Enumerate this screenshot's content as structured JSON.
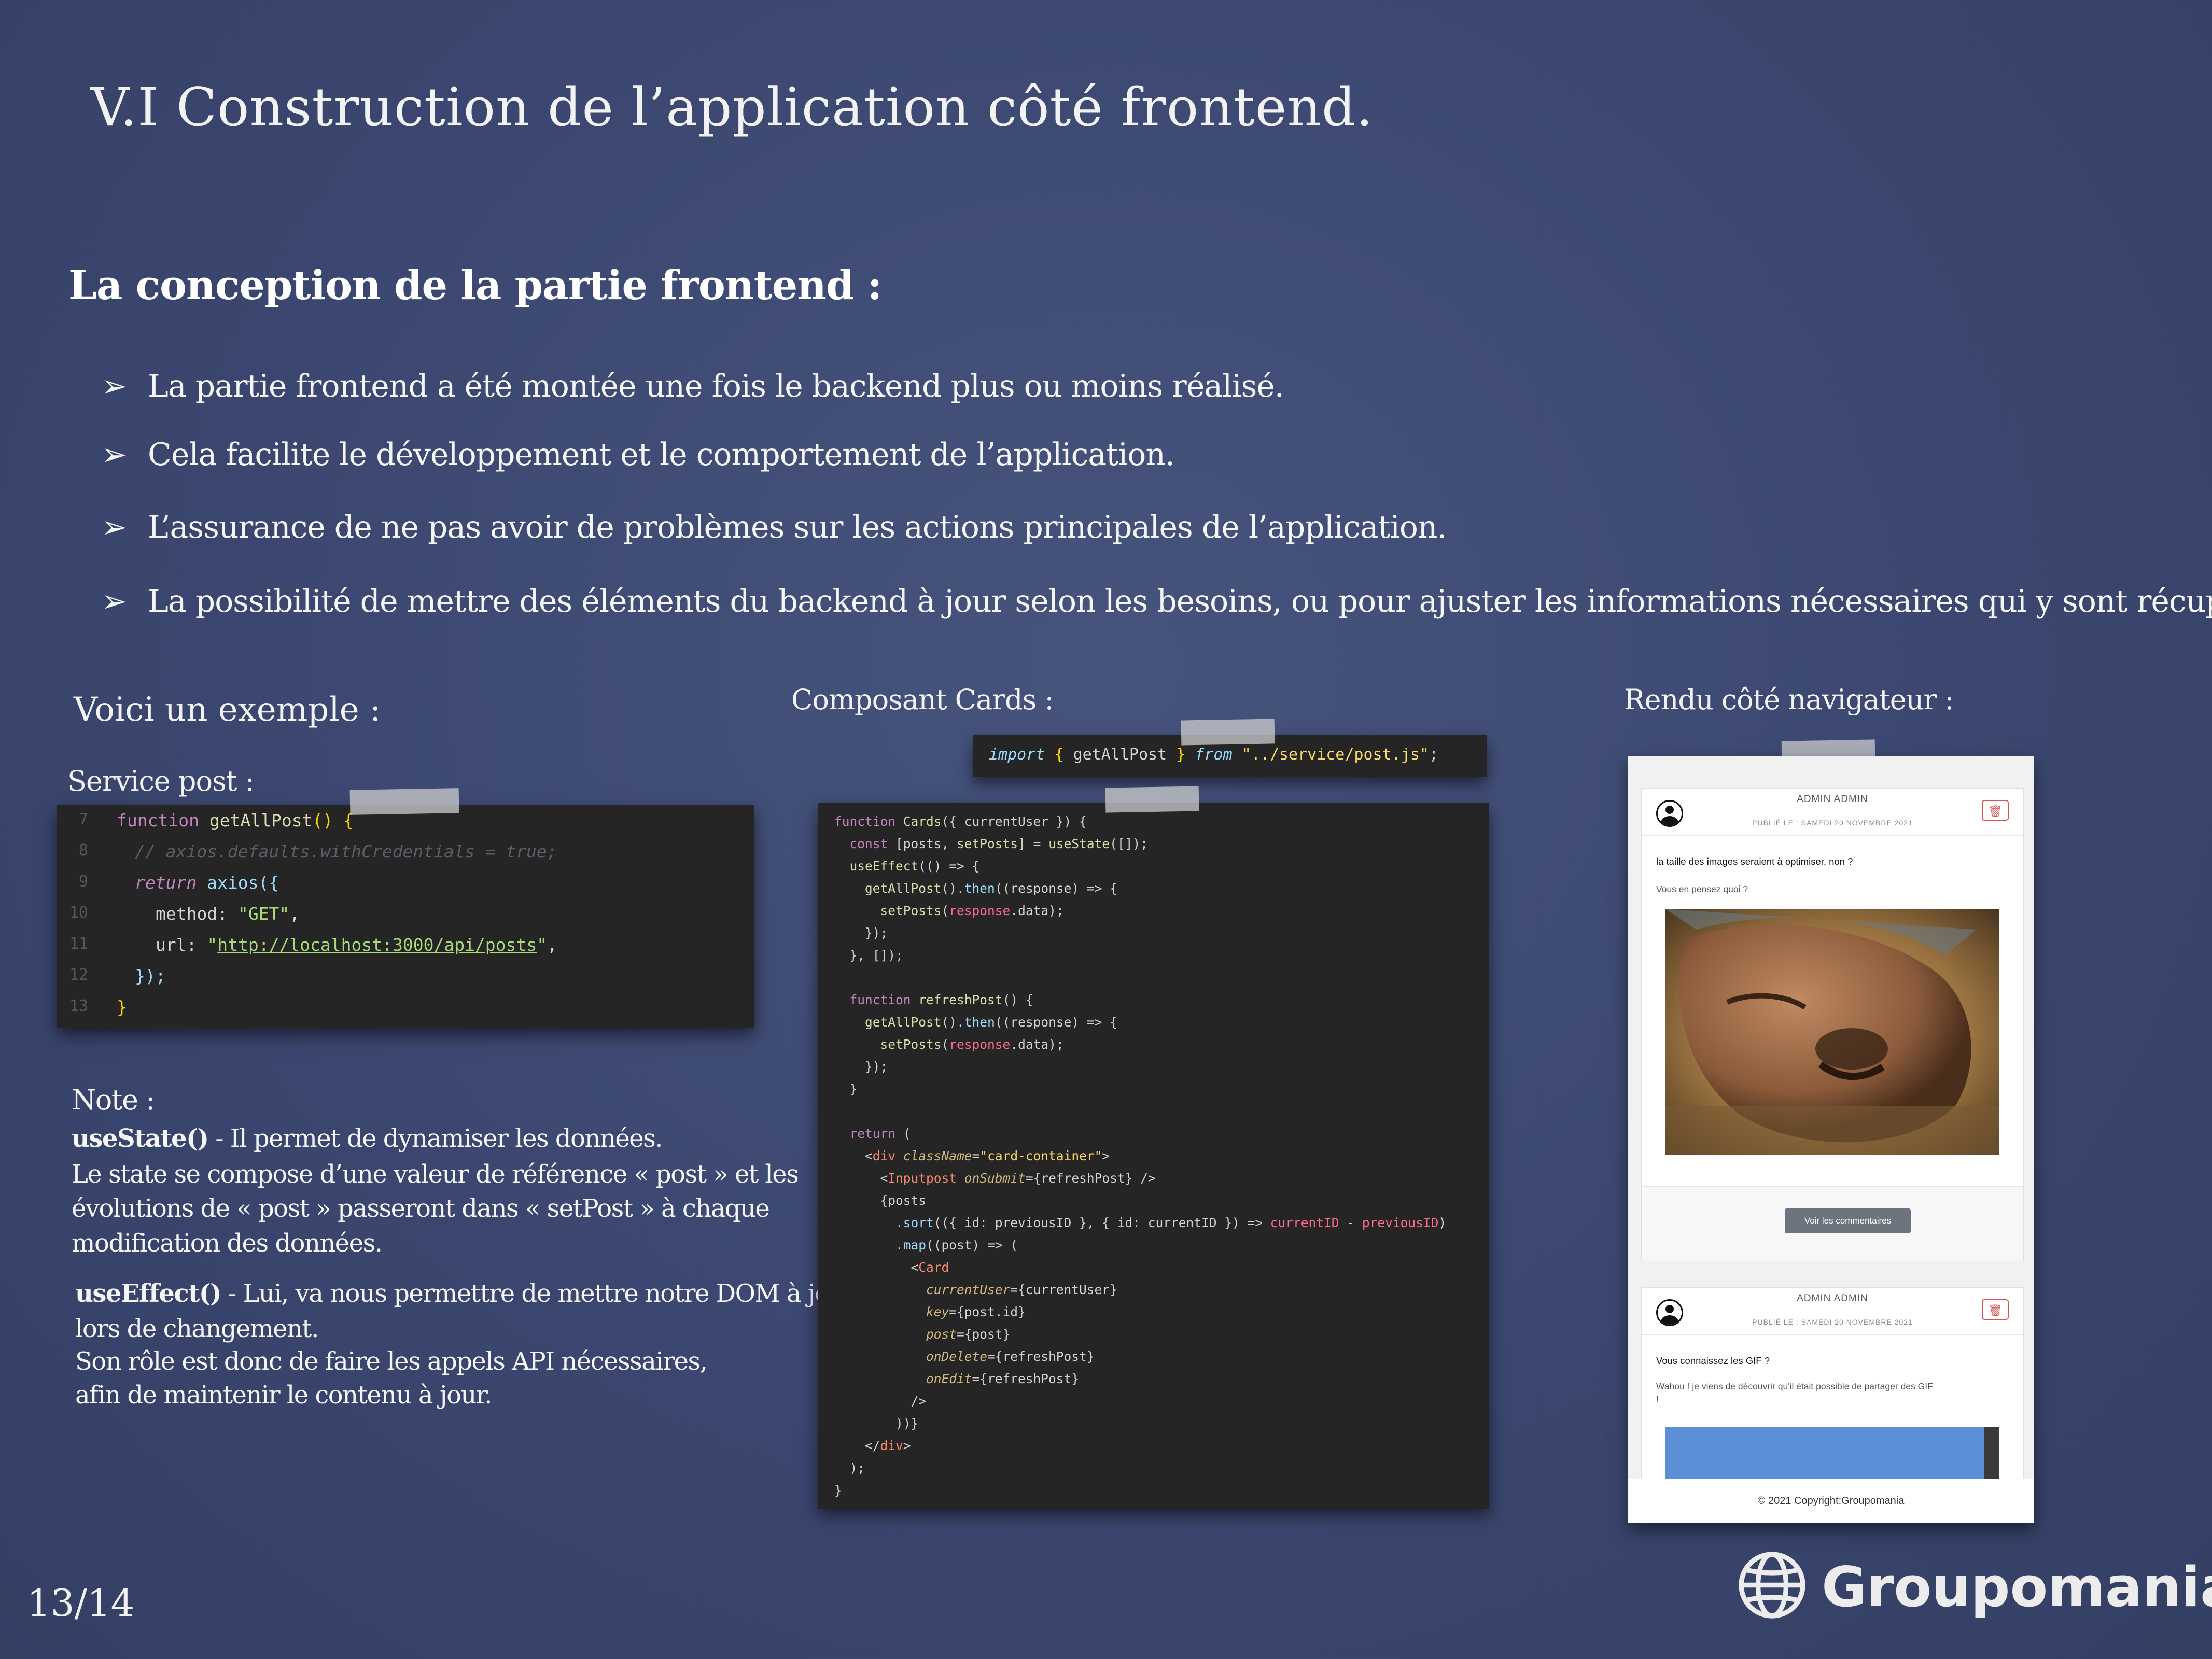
{
  "slide": {
    "title": "V.I  Construction de l’application côté frontend.",
    "subtitle": "La conception de la partie frontend :",
    "bullets": [
      "La partie frontend a été montée une fois le backend plus ou moins réalisé.",
      "Cela facilite le développement et le comportement de l’application.",
      "L’assurance de ne pas avoir de problèmes sur les actions principales de l’application.",
      "La possibilité de mettre des éléments du backend à jour selon les besoins, ou pour ajuster les informations nécessaires qui y sont récupérées."
    ],
    "bullet_glyph": "➢",
    "page_number": "13/14"
  },
  "example": {
    "heading": "Voici un exemple :",
    "service_label": "Service post :",
    "service_code": {
      "line_numbers": [
        "7",
        "8",
        "9",
        "10",
        "11",
        "12",
        "13"
      ],
      "fn_keyword": "function",
      "fn_name": "getAllPost",
      "fn_tail": "() {",
      "comment": "// axios.defaults.withCredentials = true;",
      "return_kw": "return",
      "axios_call": "axios({",
      "method_key": "method:",
      "method_value": "\"GET\"",
      "comma": ",",
      "url_key": "url:",
      "url_value": "http://localhost:3000/api/posts",
      "close_call": "});",
      "close_fn": "}"
    }
  },
  "note": {
    "heading": "Note :",
    "usestate_term": "useState()",
    "usestate_line1": " - Il permet de dynamiser les données.",
    "usestate_line2": "Le state se compose d’une valeur de référence « post » et les",
    "usestate_line3": "évolutions de « post » passeront dans « setPost » à chaque",
    "usestate_line4": "modification  des données.",
    "useeffect_term": "useEffect()",
    "useeffect_line1": " - Lui,  va nous permettre de mettre notre DOM à jour,",
    "useeffect_line2": " lors de changement.",
    "useeffect_line3": "Son rôle est donc de faire les appels API nécessaires,",
    "useeffect_line4": " afin de maintenir  le contenu à jour."
  },
  "cards": {
    "label": "Composant Cards :",
    "import_line": {
      "kw": "import",
      "open": "{",
      "name": "getAllPost",
      "close": "}",
      "from": "from",
      "path": "\"../service/post.js\"",
      "semi": ";"
    },
    "code_lines": [
      "function Cards({ currentUser }) {",
      "  const [posts, setPosts] = useState([]);",
      "  useEffect(() => {",
      "    getAllPost().then((response) => {",
      "      setPosts(response.data);",
      "    });",
      "  }, []);",
      "",
      "  function refreshPost() {",
      "    getAllPost().then((response) => {",
      "      setPosts(response.data);",
      "    });",
      "  }",
      "",
      "  return (",
      "    <div className=\"card-container\">",
      "      <Inputpost onSubmit={refreshPost} />",
      "      {posts",
      "        .sort(({ id: previousID }, { id: currentID }) => currentID - previousID)",
      "        .map((post) => (",
      "          <Card",
      "            currentUser={currentUser}",
      "            key={post.id}",
      "            post={post}",
      "            onDelete={refreshPost}",
      "            onEdit={refreshPost}",
      "          />",
      "        ))}",
      "    </div>",
      "  );",
      "}"
    ]
  },
  "browser": {
    "label": "Rendu  côté navigateur :",
    "posts": [
      {
        "author": "ADMIN ADMIN",
        "date": "PUBLIÉ LE : SAMEDI 20 NOVEMBRE 2021",
        "title": "la taille des images seraient à optimiser, non ?",
        "body": "Vous en pensez quoi ?",
        "button": "Voir les commentaires",
        "delete_icon": "trash-icon"
      },
      {
        "author": "ADMIN ADMIN",
        "date": "PUBLIÉ LE : SAMEDI 20 NOVEMBRE 2021",
        "title": "Vous connaissez les GIF ?",
        "body_line1": "Wahou ! je viens de découvrir qu'il était possible de partager des GIF",
        "body_line2": "!",
        "delete_icon": "trash-icon"
      }
    ],
    "footer": "© 2021 Copyright:Groupomania"
  },
  "logo": {
    "text": "Groupomania",
    "icon": "globe-icon"
  },
  "colors": {
    "background": "#3d4a70",
    "code_bg": "#252526",
    "delete_red": "#d9534f",
    "button_grey": "#6c757d"
  }
}
